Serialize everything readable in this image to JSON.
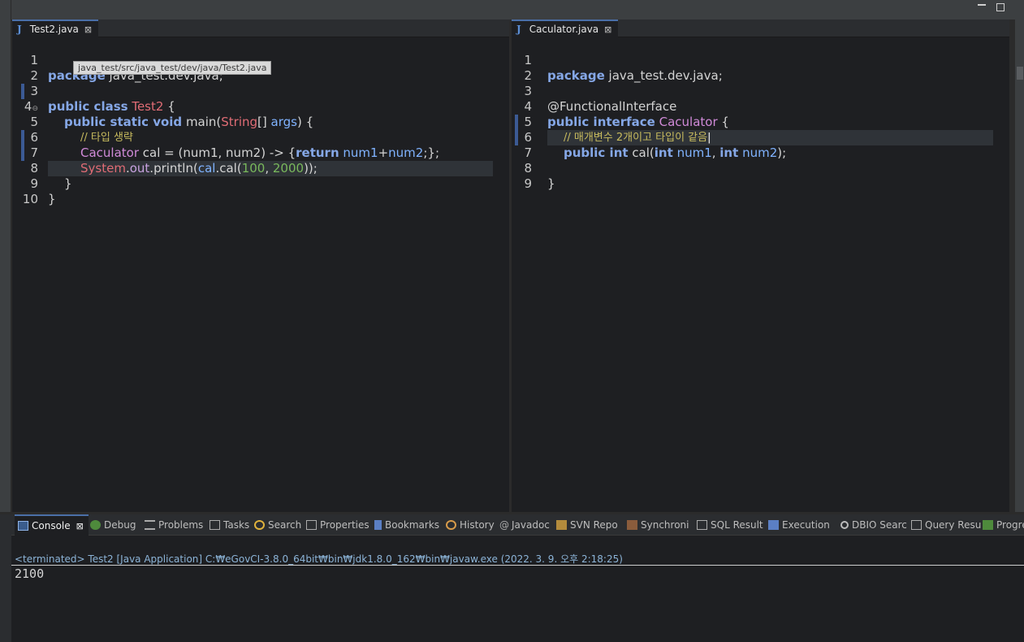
{
  "left_editor": {
    "tab_label": "Test2.java",
    "tooltip": "java_test/src/java_test/dev/java/Test2.java",
    "line_numbers": [
      "1",
      "2",
      "3",
      "4",
      "5",
      "6",
      "7",
      "8",
      "9",
      "10"
    ]
  },
  "right_editor": {
    "tab_label": "Caculator.java",
    "line_numbers": [
      "1",
      "2",
      "3",
      "4",
      "5",
      "6",
      "7",
      "8",
      "9"
    ]
  },
  "left_code": {
    "l1_kw": "package",
    "l1_rest": " java_test.dev.java;",
    "l3_kw": "public class",
    "l3_cls": "Test2",
    "l3_rest": " {",
    "l4_kw": "public static void",
    "l4_a": " main(",
    "l4_cls": "String",
    "l4_b": "[] ",
    "l4_var": "args",
    "l4_c": ") {",
    "l5_cmt": "// 타입 생략",
    "l6_iface": "Caculator",
    "l6_a": " cal = (num1, num2) -> {",
    "l6_kw": "return",
    "l6_var1": "num1",
    "l6_plus": "+",
    "l6_var2": "num2",
    "l6_end": ";};",
    "l7_cls": "System",
    "l7_a": ".",
    "l7_field": "out",
    "l7_b": ".println(",
    "l7_var": "cal",
    "l7_c": ".cal(",
    "l7_n1": "100",
    "l7_comma": ", ",
    "l7_n2": "2000",
    "l7_end": "));",
    "l8": "}",
    "l9": "}"
  },
  "right_code": {
    "l1_kw": "package",
    "l1_rest": " java_test.dev.java;",
    "l3": "@FunctionalInterface",
    "l4_kw": "public interface",
    "l4_iface": "Caculator",
    "l4_rest": " {",
    "l5_cmt": "// 매개변수 2개이고 타입이 같음",
    "l6_kw1": "public int",
    "l6_a": " cal(",
    "l6_kw2": "int",
    "l6_var1": "num1",
    "l6_comma": ", ",
    "l6_kw3": "int",
    "l6_var2": "num2",
    "l6_end": ");",
    "l8": "}"
  },
  "bottom_tabs": [
    "Console",
    "Debug",
    "Problems",
    "Tasks",
    "Search",
    "Properties",
    "Bookmarks",
    "History",
    "Javadoc",
    "SVN Repo",
    "Synchroni",
    "SQL Result",
    "Execution",
    "DBIO Searc",
    "Query Resu",
    "Progre"
  ],
  "console": {
    "terminated": "<terminated> Test2 [Java Application] C:₩eGovCI-3.8.0_64bit₩bin₩jdk1.8.0_162₩bin₩javaw.exe  (2022. 3. 9. 오후 2:18:25)",
    "output": "2100"
  },
  "colors": {
    "accent": "#4a6fa8",
    "keyword": "#85a7e6",
    "class": "#e06c75",
    "comment": "#c8bb5e",
    "number": "#79b85c"
  }
}
